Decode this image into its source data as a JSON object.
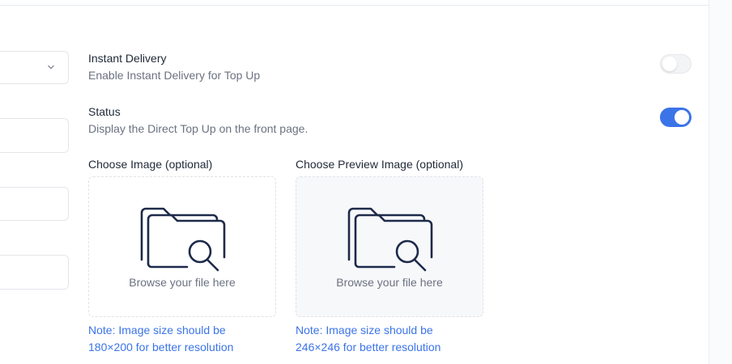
{
  "instant_delivery": {
    "title": "Instant Delivery",
    "description": "Enable Instant Delivery for Top Up",
    "enabled": false
  },
  "status": {
    "title": "Status",
    "description": "Display the Direct Top Up on the front page.",
    "enabled": true
  },
  "image_upload": {
    "label": "Choose Image (optional)",
    "browse_text": "Browse your file here",
    "note_line1": "Note: Image size should be",
    "note_line2": "180×200 for better resolution"
  },
  "preview_upload": {
    "label": "Choose Preview Image (optional)",
    "browse_text": "Browse your file here",
    "note_line1": "Note: Image size should be",
    "note_line2": "246×246 for better resolution"
  },
  "colors": {
    "accent": "#3b74e8",
    "icon": "#1e2a4a",
    "muted_text": "#6b7280"
  },
  "icons": [
    "chevron-down-icon",
    "folder-search-icon"
  ]
}
